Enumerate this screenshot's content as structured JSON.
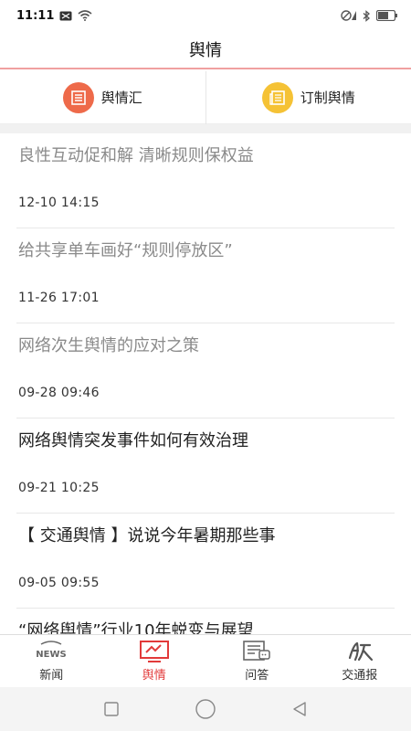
{
  "status_bar": {
    "time": "11:11",
    "icons": [
      "message-icon",
      "wifi-icon",
      "signal-icon",
      "bluetooth-icon",
      "battery-icon"
    ]
  },
  "header": {
    "title": "舆情"
  },
  "quick_actions": [
    {
      "label": "舆情汇",
      "icon": "document-icon",
      "color": "#ee6a4a"
    },
    {
      "label": "订制舆情",
      "icon": "newspaper-icon",
      "color": "#f5c235"
    }
  ],
  "news": [
    {
      "title": "良性互动促和解 清晰规则保权益",
      "time": "12-10 14:15",
      "read": true
    },
    {
      "title": "给共享单车画好“规则停放区”",
      "time": "11-26 17:01",
      "read": true
    },
    {
      "title": "网络次生舆情的应对之策",
      "time": "09-28 09:46",
      "read": true
    },
    {
      "title": "网络舆情突发事件如何有效治理",
      "time": "09-21 10:25",
      "read": false
    },
    {
      "title": "【 交通舆情 】说说今年暑期那些事",
      "time": "09-05 09:55",
      "read": false
    },
    {
      "title": "“网络舆情”行业10年蜕变与展望",
      "time": "",
      "read": false
    }
  ],
  "tabs": [
    {
      "label": "新闻",
      "icon": "news-icon",
      "active": false
    },
    {
      "label": "舆情",
      "icon": "monitor-icon",
      "active": true
    },
    {
      "label": "问答",
      "icon": "qa-icon",
      "active": false
    },
    {
      "label": "交通报",
      "icon": "newspaper-logo-icon",
      "active": false
    }
  ],
  "colors": {
    "accent": "#e23a3a",
    "header_border": "#f0a0a0"
  }
}
